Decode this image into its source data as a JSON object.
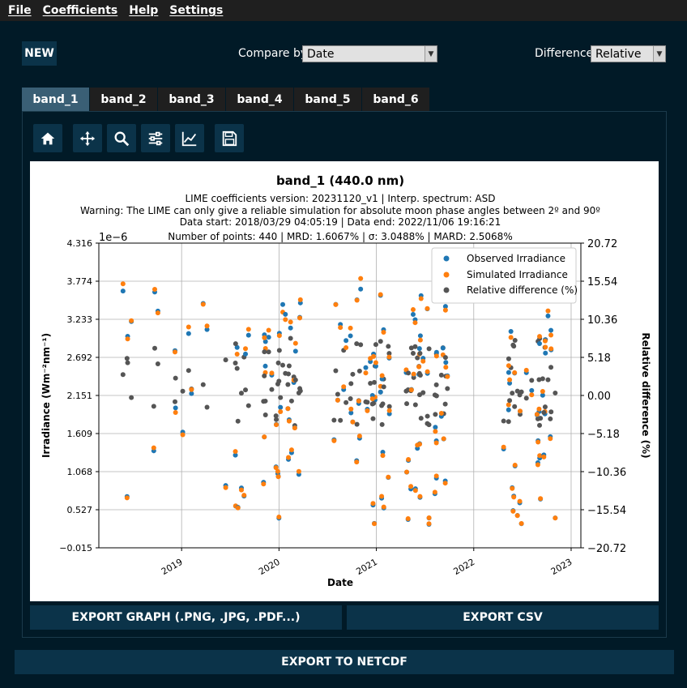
{
  "menu": [
    "File",
    "Coefficients",
    "Help",
    "Settings"
  ],
  "new_button": "NEW",
  "compare": {
    "label": "Compare by:",
    "value": "Date"
  },
  "difference": {
    "label": "Difference:",
    "value": "Relative"
  },
  "tabs": [
    "band_1",
    "band_2",
    "band_3",
    "band_4",
    "band_5",
    "band_6"
  ],
  "active_tab": "band_1",
  "toolbar": [
    "home-icon",
    "pan-icon",
    "zoom-icon",
    "configure-subplots-icon",
    "edit-axis-icon",
    "save-icon"
  ],
  "export": {
    "graph": "EXPORT GRAPH (.PNG, .JPG, .PDF...)",
    "csv": "EXPORT CSV",
    "netcdf": "EXPORT TO NETCDF"
  },
  "chart_data": {
    "type": "scatter",
    "title": "band_1 (440.0 nm)",
    "subtitles": [
      "LIME coefficients version: 20231120_v1 | Interp. spectrum: ASD",
      "Warning: The LIME can only give a reliable simulation for absolute moon phase angles between 2º and 90º",
      "Data start: 2018/03/29 04:05:19 | Data end: 2022/11/06 19:16:21",
      "Number of points: 440 | MRD: 1.6067% | σ: 3.0488% | MARD: 2.5068%"
    ],
    "xlabel": "Date",
    "ylabel": "Irradiance (Wm⁻²nm⁻¹)",
    "ylabel_right": "Relative difference (%)",
    "y_offset_text": "1e−6",
    "x_ticks": [
      "2019",
      "2020",
      "2021",
      "2022",
      "2023"
    ],
    "y_ticks": [
      "4.316",
      "3.774",
      "3.233",
      "2.692",
      "2.151",
      "1.609",
      "1.068",
      "0.527",
      "−0.015"
    ],
    "y2_ticks": [
      "20.72",
      "15.54",
      "10.36",
      "5.18",
      "0.00",
      "−5.18",
      "−10.36",
      "−15.54",
      "−20.72"
    ],
    "ylim": [
      -0.015,
      4.316
    ],
    "y2lim": [
      -20.72,
      20.72
    ],
    "xlim": [
      2018.15,
      2023.1
    ],
    "grid": true,
    "legend_position": "top-right",
    "series": [
      {
        "name": "Observed Irradiance",
        "color": "#1f77b4"
      },
      {
        "name": "Simulated Irradiance",
        "color": "#ff7f0e"
      },
      {
        "name": "Relative difference (%)",
        "color": "#555555"
      }
    ]
  }
}
